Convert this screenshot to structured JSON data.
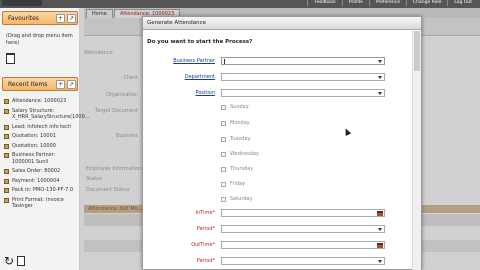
{
  "topbar": {
    "links": [
      "Feedback",
      "Profile",
      "Preference",
      "Change Role",
      "Log Out"
    ]
  },
  "favourites": {
    "title": "Favourites",
    "hint": "(Drag and drop menu item here)"
  },
  "recent": {
    "title": "Recent Items",
    "items": [
      "Attendance: 1000023",
      "Salary Structure: X_HRR_SalaryStructure(1000...",
      "Lead: infotech info tech",
      "Quotation: 10001",
      "Quotation: 10000",
      "Business Partner: 1000001 Sunil",
      "Sales Order: 80002",
      "Payment: 1000004",
      "Pack in: PMO-130-PF-7.0",
      "Print Format: Invoice Tasinger"
    ]
  },
  "bg": {
    "tabs": [
      "Home",
      "Attendance: 1000023"
    ],
    "labels": [
      "Attendance",
      "Client",
      "Organization",
      "Target Document",
      "Business",
      "Employee Information",
      "Status",
      "Document Status"
    ],
    "section": "Attendance: Not Mo..."
  },
  "dialog": {
    "title": "Generate Attendance",
    "question": "Do you want to start the Process?",
    "fields": {
      "business_partner": "Business Partner",
      "department": "Department",
      "position": "Position"
    },
    "days": [
      "Sunday",
      "Monday",
      "Tuesday",
      "Wednesday",
      "Thursday",
      "Friday",
      "Saturday"
    ],
    "time_fields": {
      "intime": "InTime",
      "period1": "Period",
      "outtime": "OutTime",
      "period2": "Period"
    },
    "required_mark": "*"
  },
  "colors": {
    "panel_header": "#f7b56b",
    "label_link": "#1a3a9c",
    "label_required": "#c02020"
  }
}
